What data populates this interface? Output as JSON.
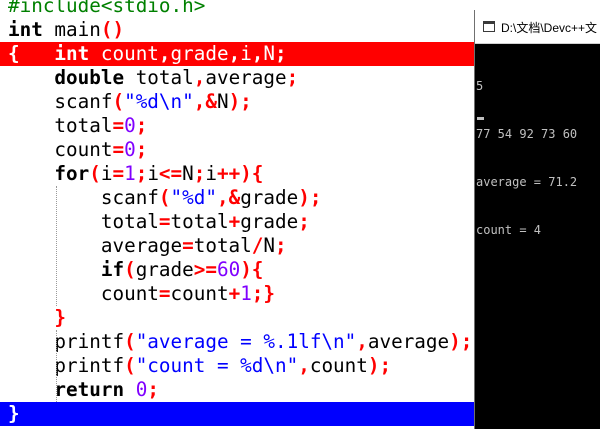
{
  "editor": {
    "lines": [
      {
        "id": "include",
        "t1": "#include<stdio.h>"
      },
      {
        "id": "main",
        "t1": "int",
        "t2": " main",
        "t3": "()"
      },
      {
        "id": "decl1",
        "t1": "{",
        "t2": "   int",
        "t3": " count",
        "t4": ",",
        "t5": "grade",
        "t6": ",",
        "t7": "i",
        "t8": ",",
        "t9": "N",
        "t10": ";"
      },
      {
        "id": "decl2",
        "t1": "    double",
        "t2": " total",
        "t3": ",",
        "t4": "average",
        "t5": ";"
      },
      {
        "id": "scanf1",
        "t1": "    scanf",
        "t2": "(",
        "t3": "\"%d\\n\"",
        "t4": ",&",
        "t5": "N",
        "t6": ");"
      },
      {
        "id": "total0",
        "t1": "    total",
        "t2": "=",
        "t3": "0",
        "t4": ";"
      },
      {
        "id": "count0",
        "t1": "    count",
        "t2": "=",
        "t3": "0",
        "t4": ";"
      },
      {
        "id": "for",
        "t1": "    for",
        "t2": "(",
        "t3": "i",
        "t4": "=",
        "t5": "1",
        "t6": ";",
        "t7": "i",
        "t8": "<=",
        "t9": "N",
        "t10": ";",
        "t11": "i",
        "t12": "++){"
      },
      {
        "id": "scanf2",
        "t1": "        scanf",
        "t2": "(",
        "t3": "\"%d\"",
        "t4": ",&",
        "t5": "grade",
        "t6": ");"
      },
      {
        "id": "sum",
        "t1": "        total",
        "t2": "=",
        "t3": "total",
        "t4": "+",
        "t5": "grade",
        "t6": ";"
      },
      {
        "id": "avg",
        "t1": "        average",
        "t2": "=",
        "t3": "total",
        "t4": "/",
        "t5": "N",
        "t6": ";"
      },
      {
        "id": "if",
        "t1": "        if",
        "t2": "(",
        "t3": "grade",
        "t4": ">=",
        "t5": "60",
        "t6": "){"
      },
      {
        "id": "inc",
        "t1": "        count",
        "t2": "=",
        "t3": "count",
        "t4": "+",
        "t5": "1",
        "t6": ";}"
      },
      {
        "id": "close-for",
        "t1": "    }"
      },
      {
        "id": "printf1",
        "t1": "    printf",
        "t2": "(",
        "t3": "\"average = %.1lf\\n\"",
        "t4": ",",
        "t5": "average",
        "t6": ");"
      },
      {
        "id": "printf2",
        "t1": "    printf",
        "t2": "(",
        "t3": "\"count = %d\\n\"",
        "t4": ",",
        "t5": "count",
        "t6": ");"
      },
      {
        "id": "return",
        "t1": "    return",
        "t2": " 0",
        "t3": ";"
      },
      {
        "id": "close-main",
        "t1": "}"
      }
    ]
  },
  "console": {
    "title": "D:\\文档\\Devc++文",
    "output": [
      "5",
      "77 54 92 73 60",
      "average = 71.2",
      "count = 4"
    ]
  },
  "colors": {
    "highlight_error": "#ff0000",
    "highlight_current": "#0000ff",
    "keyword": "#000000",
    "preprocessor": "#008000",
    "string": "#0000ff",
    "number": "#8000ff",
    "symbol": "#ff0000",
    "console_bg": "#000000",
    "console_text": "#c0c0c0"
  }
}
